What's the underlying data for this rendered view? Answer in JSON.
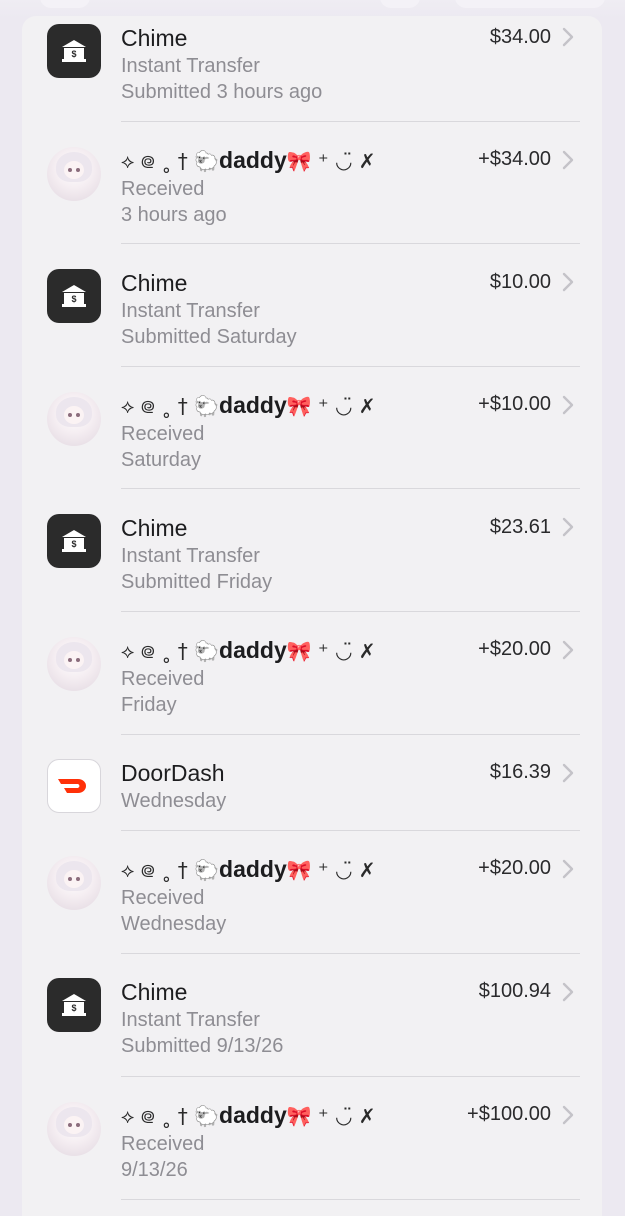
{
  "transactions": [
    {
      "kind": "bank",
      "title": "Chime",
      "line1": "Instant Transfer",
      "line2": "Submitted 3 hours ago",
      "amount": "$34.00",
      "icon": "bank-icon"
    },
    {
      "kind": "person",
      "deco_before": "⟡ ᪤ ˳ † 🐑",
      "title": "daddy",
      "deco_after": "🎀 ⁺ ◡̈ ✗",
      "line1": "Received",
      "line2": "3 hours ago",
      "amount": "+$34.00",
      "icon": "avatar"
    },
    {
      "kind": "bank",
      "title": "Chime",
      "line1": "Instant Transfer",
      "line2": "Submitted Saturday",
      "amount": "$10.00",
      "icon": "bank-icon"
    },
    {
      "kind": "person",
      "deco_before": "⟡ ᪤ ˳ † 🐑",
      "title": "daddy",
      "deco_after": "🎀 ⁺ ◡̈ ✗",
      "line1": "Received",
      "line2": "Saturday",
      "amount": "+$10.00",
      "icon": "avatar"
    },
    {
      "kind": "bank",
      "title": "Chime",
      "line1": "Instant Transfer",
      "line2": "Submitted Friday",
      "amount": "$23.61",
      "icon": "bank-icon"
    },
    {
      "kind": "person",
      "deco_before": "⟡ ᪤ ˳ † 🐑",
      "title": "daddy",
      "deco_after": "🎀 ⁺ ◡̈ ✗",
      "line1": "Received",
      "line2": "Friday",
      "amount": "+$20.00",
      "icon": "avatar"
    },
    {
      "kind": "doordash",
      "title": "DoorDash",
      "line1": "Wednesday",
      "amount": "$16.39",
      "icon": "doordash-icon"
    },
    {
      "kind": "person",
      "deco_before": "⟡ ᪤ ˳ † 🐑",
      "title": "daddy",
      "deco_after": "🎀 ⁺ ◡̈ ✗",
      "line1": "Received",
      "line2": "Wednesday",
      "amount": "+$20.00",
      "icon": "avatar"
    },
    {
      "kind": "bank",
      "title": "Chime",
      "line1": "Instant Transfer",
      "line2": "Submitted 9/13/26",
      "amount": "$100.94",
      "icon": "bank-icon"
    },
    {
      "kind": "person",
      "deco_before": "⟡ ᪤ ˳ † 🐑",
      "title": "daddy",
      "deco_after": "🎀 ⁺ ◡̈ ✗",
      "line1": "Received",
      "line2": "9/13/26",
      "amount": "+$100.00",
      "icon": "avatar"
    }
  ],
  "colors": {
    "doordash": "#ff3008",
    "bank_tile": "#2b2b2b",
    "chevron": "#c4c3c8"
  }
}
